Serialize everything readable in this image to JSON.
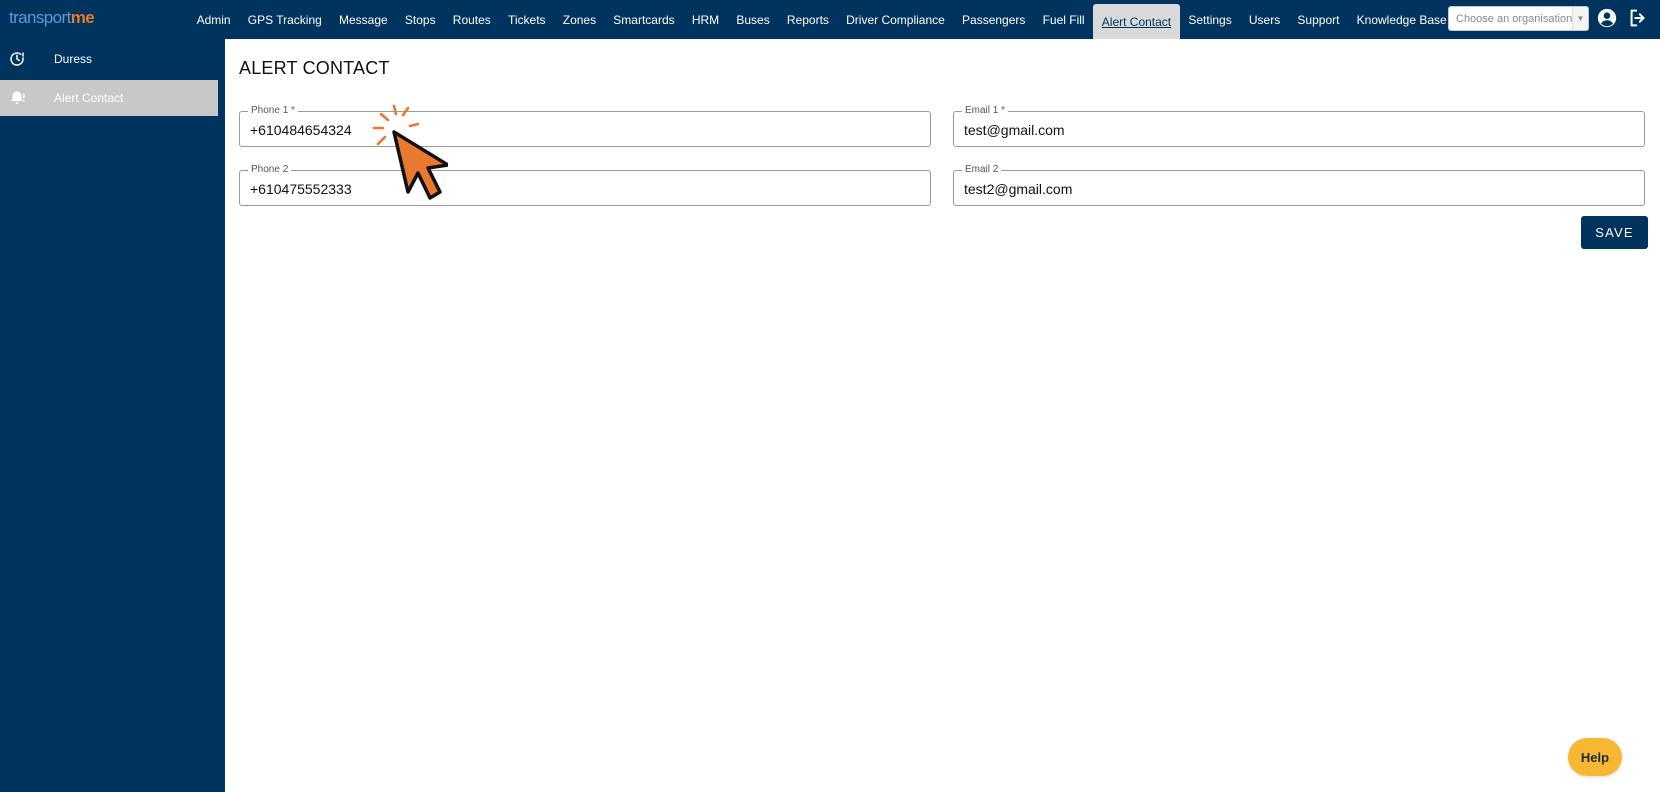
{
  "app": {
    "logo_part1": "transport",
    "logo_part2": "me"
  },
  "nav": {
    "items": [
      {
        "label": "Admin"
      },
      {
        "label": "GPS Tracking"
      },
      {
        "label": "Message"
      },
      {
        "label": "Stops"
      },
      {
        "label": "Routes"
      },
      {
        "label": "Tickets"
      },
      {
        "label": "Zones"
      },
      {
        "label": "Smartcards"
      },
      {
        "label": "HRM"
      },
      {
        "label": "Buses"
      },
      {
        "label": "Reports"
      },
      {
        "label": "Driver Compliance"
      },
      {
        "label": "Passengers"
      },
      {
        "label": "Fuel Fill"
      },
      {
        "label": "Alert Contact"
      },
      {
        "label": "Settings"
      },
      {
        "label": "Users"
      },
      {
        "label": "Support"
      },
      {
        "label": "Knowledge Base"
      }
    ],
    "active": "Alert Contact"
  },
  "org_select": {
    "placeholder": "Choose an organisation"
  },
  "icons": {
    "user": "user-circle-icon",
    "logout": "logout-icon",
    "duress": "clock-alert-icon",
    "alert": "bell-alert-icon"
  },
  "sidebar": {
    "items": [
      {
        "label": "Duress"
      },
      {
        "label": "Alert Contact"
      }
    ]
  },
  "page": {
    "title": "ALERT CONTACT"
  },
  "form": {
    "phone1": {
      "label": "Phone 1 *",
      "value": "+610484654324"
    },
    "phone2": {
      "label": "Phone 2",
      "value": "+610475552333"
    },
    "email1": {
      "label": "Email 1 *",
      "value": "test@gmail.com"
    },
    "email2": {
      "label": "Email 2",
      "value": "test2@gmail.com"
    },
    "save_label": "SAVE"
  },
  "help": {
    "label": "Help"
  },
  "colors": {
    "primary": "#00335e",
    "accent": "#e8792e",
    "help": "#f7b733"
  }
}
